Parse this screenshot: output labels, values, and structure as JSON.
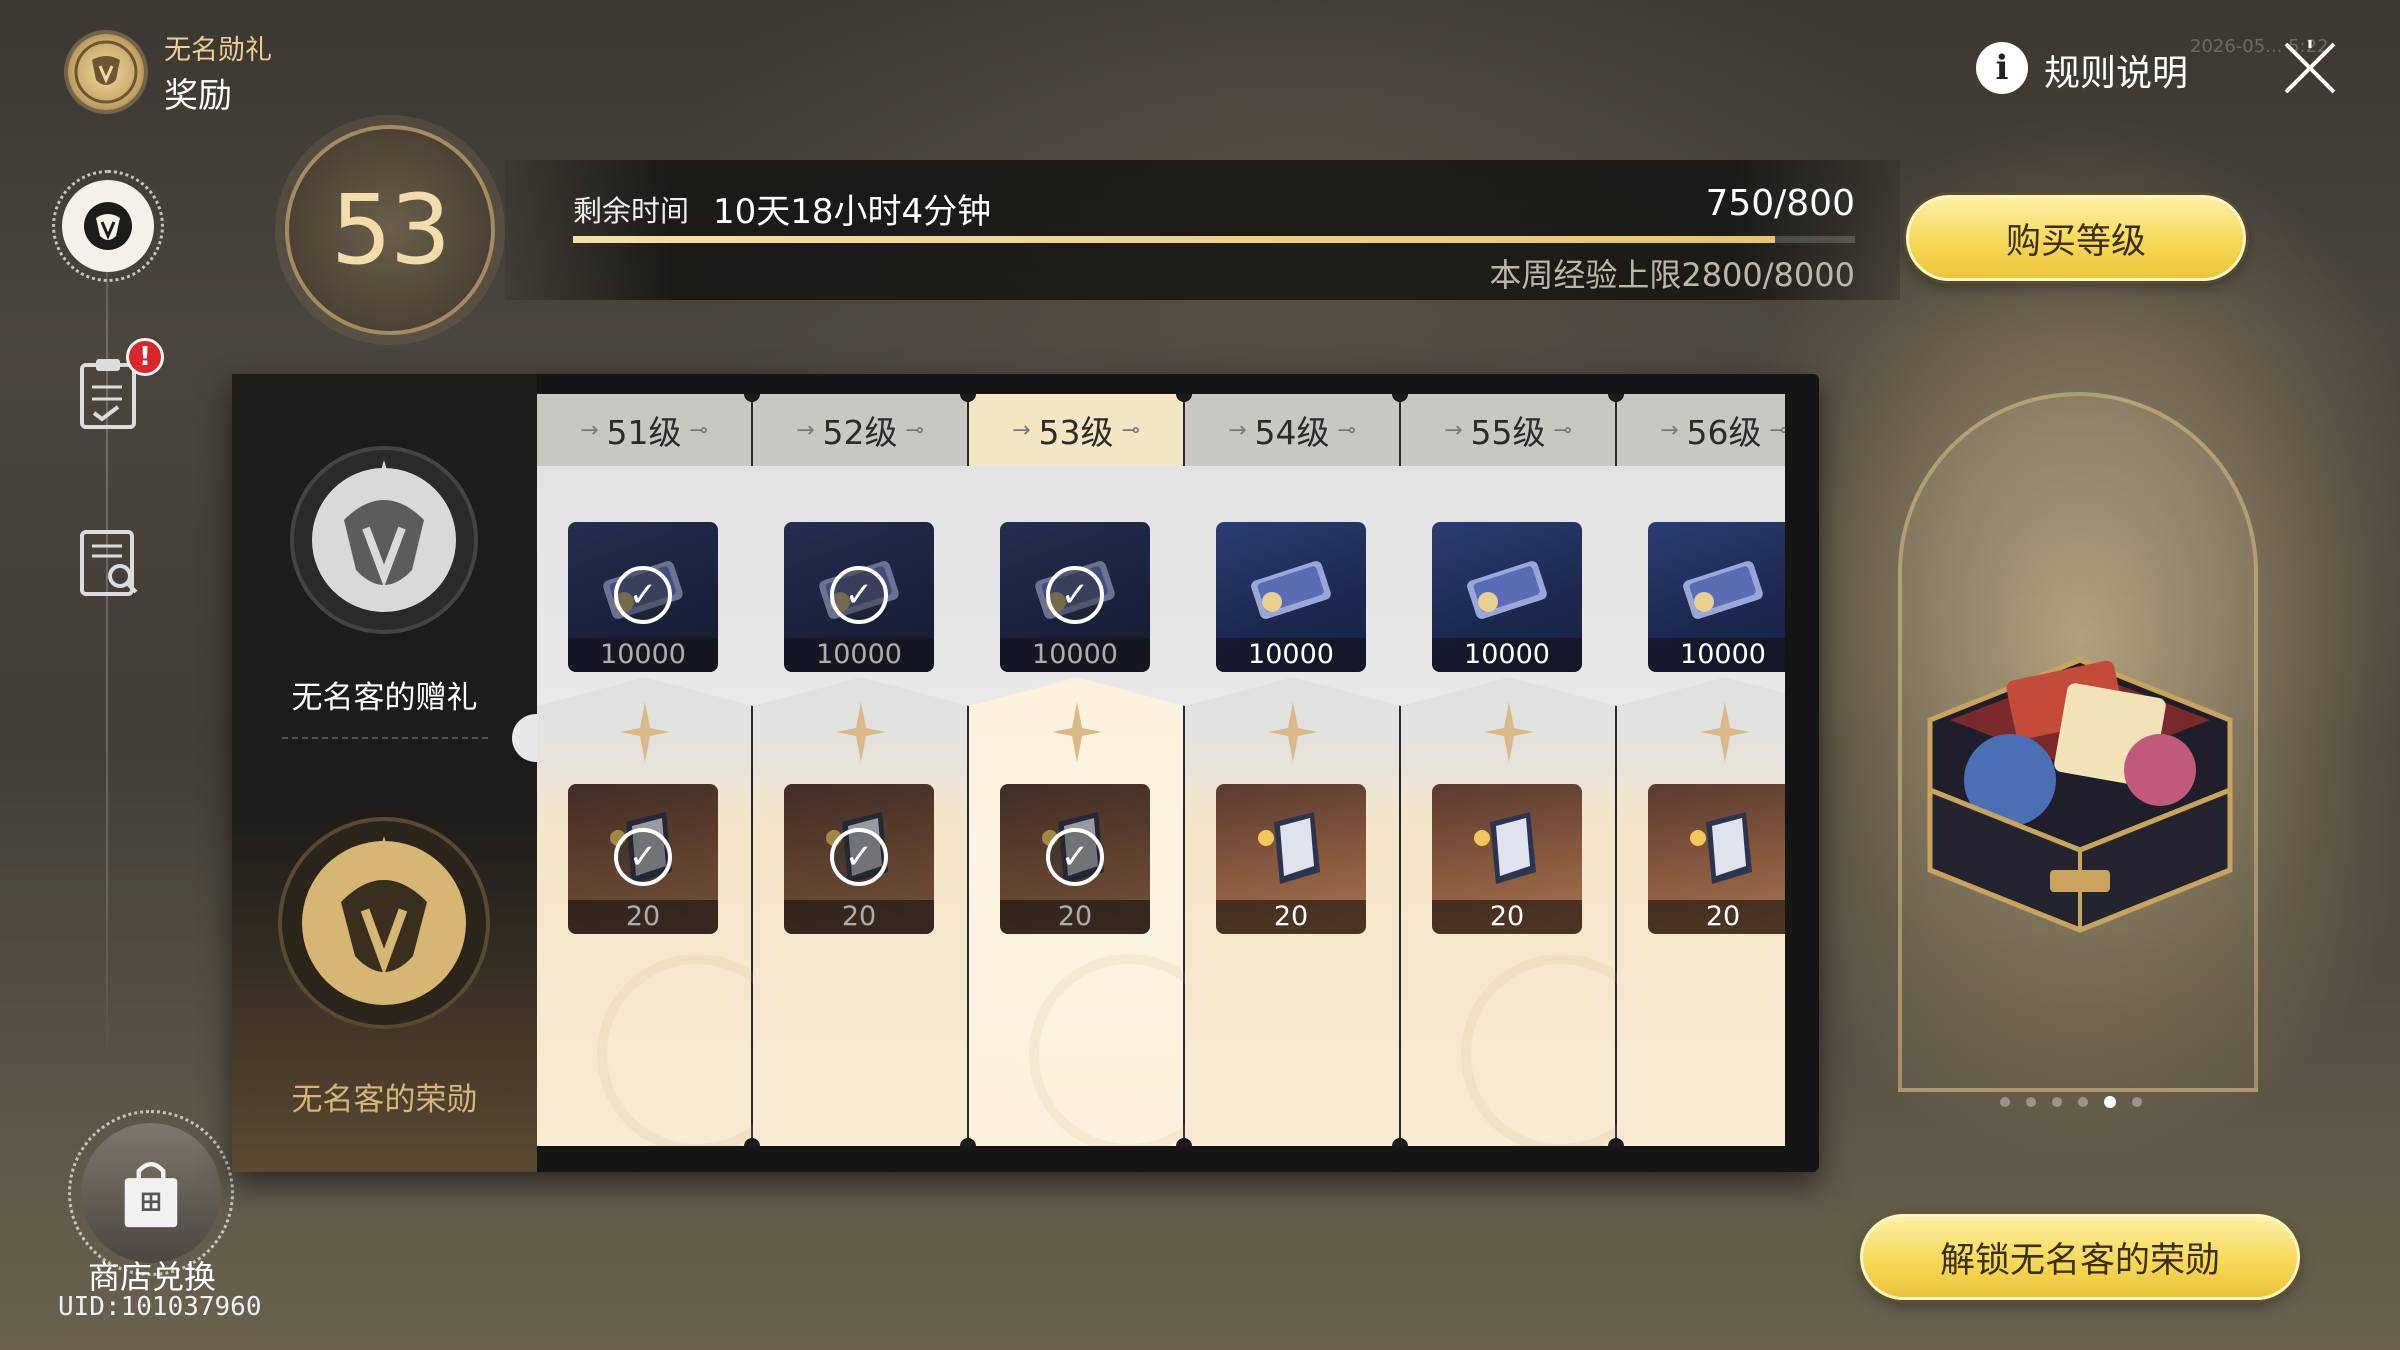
{
  "header": {
    "subtitle": "无名勋礼",
    "title": "奖励",
    "rules_label": "规则说明",
    "timestamp": "2026-05... 5:22"
  },
  "level": {
    "current": "53",
    "remaining_label": "剩余时间",
    "remaining_value": "10天18小时4分钟",
    "exp_value": "750/800",
    "exp_progress": 0.9375,
    "weekly_cap": "本周经验上限2800/8000",
    "buy_button": "购买等级"
  },
  "sidebar": {
    "notification_badge": "!",
    "shop_label": "商店兑换",
    "uid": "UID:101037960"
  },
  "tracks": {
    "free_label": "无名客的赠礼",
    "paid_label": "无名客的荣勋"
  },
  "levels": [
    {
      "label": "51级",
      "free_qty": "10000",
      "paid_qty": "20",
      "claimed": true
    },
    {
      "label": "52级",
      "free_qty": "10000",
      "paid_qty": "20",
      "claimed": true
    },
    {
      "label": "53级",
      "free_qty": "10000",
      "paid_qty": "20",
      "claimed": true,
      "current": true
    },
    {
      "label": "54级",
      "free_qty": "10000",
      "paid_qty": "20",
      "claimed": false
    },
    {
      "label": "55级",
      "free_qty": "10000",
      "paid_qty": "20",
      "claimed": false
    },
    {
      "label": "56级",
      "free_qty": "10000",
      "paid_qty": "20",
      "claimed": false
    }
  ],
  "preview": {
    "unlock_button": "解锁无名客的荣勋",
    "pager_active_index": 4,
    "pager_count": 6
  },
  "colors": {
    "accent_gold": "#f6d957",
    "paid_text": "#d4b67a",
    "badge_red": "#d8262c"
  }
}
